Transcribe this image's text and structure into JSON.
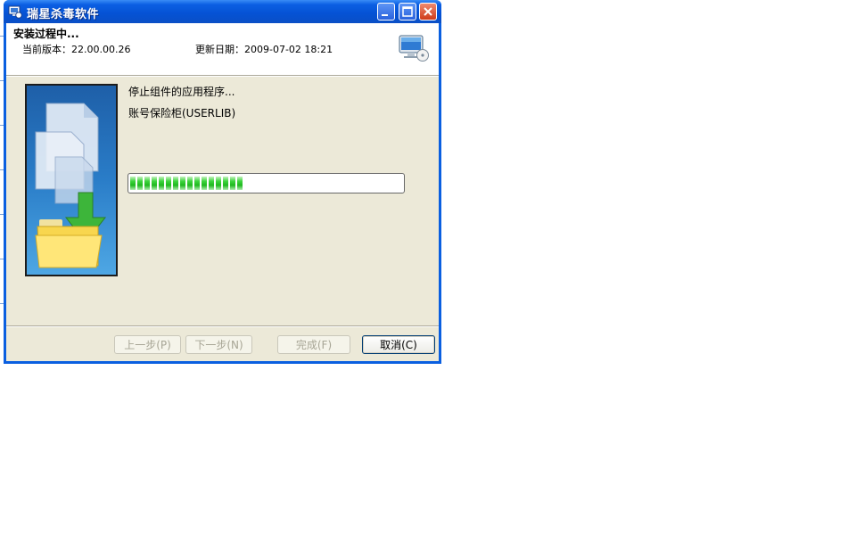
{
  "window": {
    "title": "瑞星杀毒软件"
  },
  "header": {
    "title": "安装过程中...",
    "version_label": "当前版本：",
    "version": "22.00.00.26",
    "date_label": "更新日期：",
    "date": "2009-07-02 18:21"
  },
  "status": {
    "line1": "停止组件的应用程序...",
    "line2": "账号保险柜(USERLIB)"
  },
  "progress": {
    "percent": 42
  },
  "buttons": {
    "prev": "上一步(P)",
    "next": "下一步(N)",
    "finish": "完成(F)",
    "cancel": "取消(C)"
  },
  "icons": {
    "app": "rising-app-icon",
    "monitor": "monitor-cd-icon",
    "minimize": "minimize-icon",
    "maximize": "maximize-icon",
    "close": "close-icon"
  },
  "colors": {
    "titlebar": "#0a5fe0",
    "progress": "#1fb81f",
    "dialog_bg": "#ece9d8"
  }
}
